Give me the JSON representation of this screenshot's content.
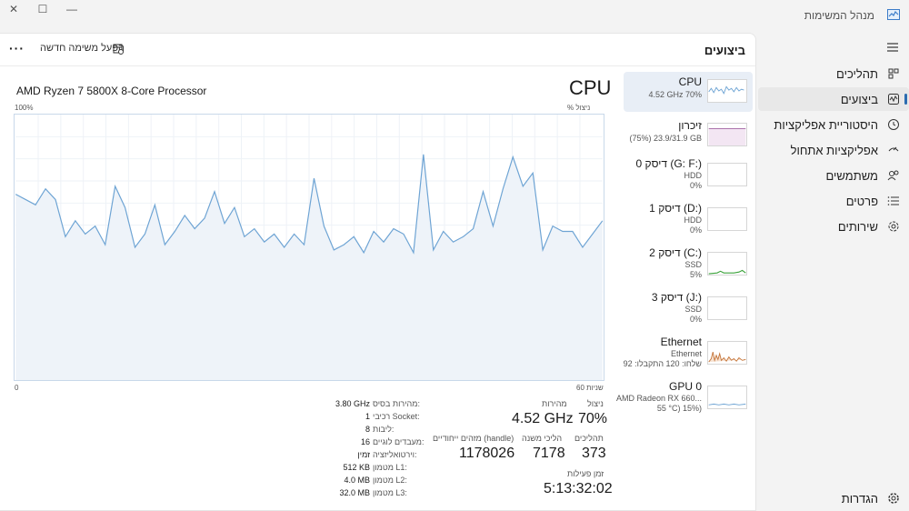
{
  "app": {
    "title": "מנהל המשימות",
    "icon": "task-manager-icon"
  },
  "window_buttons": {
    "close": "✕",
    "maximize": "☐",
    "minimize": "—"
  },
  "sidebar": {
    "items": [
      {
        "label": "תהליכים",
        "icon": "processes-icon"
      },
      {
        "label": "ביצועים",
        "icon": "performance-icon",
        "active": true
      },
      {
        "label": "היסטוריית אפליקציות",
        "icon": "history-icon"
      },
      {
        "label": "אפליקציות אתחול",
        "icon": "startup-icon"
      },
      {
        "label": "משתמשים",
        "icon": "users-icon"
      },
      {
        "label": "פרטים",
        "icon": "details-icon"
      },
      {
        "label": "שירותים",
        "icon": "services-icon"
      }
    ],
    "settings_label": "הגדרות"
  },
  "header": {
    "title": "ביצועים",
    "new_task": "הפעל משימה חדשה",
    "more": "···"
  },
  "perf_items": [
    {
      "title": "CPU",
      "sub1": "4.52 GHz  70%",
      "sub2": "",
      "thumb": "cpu",
      "active": true
    },
    {
      "title": "זיכרון",
      "sub1": "(75%) 23.9/31.9 GB",
      "sub2": "",
      "thumb": "memory"
    },
    {
      "title": "דיסק 0 (G: F:)",
      "sub1": "HDD",
      "sub2": "0%",
      "thumb": "disk"
    },
    {
      "title": "דיסק 1 (D:)",
      "sub1": "HDD",
      "sub2": "0%",
      "thumb": "disk"
    },
    {
      "title": "דיסק 2 (C:)",
      "sub1": "SSD",
      "sub2": "5%",
      "thumb": "disk-active"
    },
    {
      "title": "דיסק 3 (J:)",
      "sub1": "SSD",
      "sub2": "0%",
      "thumb": "disk"
    },
    {
      "title": "Ethernet",
      "sub1": "Ethernet",
      "sub2": "שלחו: 120 התקבלו: 92",
      "thumb": "ethernet"
    },
    {
      "title": "GPU 0",
      "sub1": "AMD Radeon RX 660...",
      "sub2": "55 °C) 15%)",
      "thumb": "gpu"
    }
  ],
  "cpu": {
    "title": "CPU",
    "model": "AMD Ryzen 7 5800X 8-Core Processor",
    "y_max_label": "100%",
    "y_unit_label": "% ניצול",
    "x_left_label": "0",
    "x_right_label": "60 שניות"
  },
  "stats": {
    "utilization_label": "ניצול",
    "utilization": "70%",
    "speed_label": "מהירות",
    "speed": "4.52 GHz",
    "processes_label": "תהליכים",
    "processes": "373",
    "threads_label": "הליכי משנה",
    "threads": "7178",
    "handles_label": "מזהים ייחודיים (handle)",
    "handles": "1178026",
    "uptime_label": "זמן פעילות",
    "uptime": "5:13:32:02"
  },
  "specs": [
    {
      "key": "מהירות בסיס:",
      "value": "3.80 GHz"
    },
    {
      "key": "רכיבי Socket:",
      "value": "1"
    },
    {
      "key": "ליבות:",
      "value": "8"
    },
    {
      "key": "מעבדים לוגיים:",
      "value": "16"
    },
    {
      "key": "וירטואליזציה:",
      "value": "זמין"
    },
    {
      "key": "מטמון L1:",
      "value": "512 KB"
    },
    {
      "key": "מטמון L2:",
      "value": "4.0 MB"
    },
    {
      "key": "מטמון L3:",
      "value": "32.0 MB"
    }
  ],
  "chart_data": {
    "type": "area",
    "ylim": [
      0,
      100
    ],
    "xlim": [
      0,
      60
    ],
    "color": "#6ea4d4",
    "fill": "#eef3f9",
    "values": [
      70,
      68,
      66,
      72,
      68,
      54,
      60,
      55,
      58,
      51,
      73,
      65,
      50,
      55,
      66,
      51,
      56,
      62,
      57,
      61,
      71,
      59,
      65,
      54,
      57,
      52,
      55,
      50,
      55,
      51,
      76,
      58,
      49,
      51,
      54,
      48,
      56,
      52,
      57,
      55,
      48,
      85,
      49,
      56,
      52,
      54,
      57,
      71,
      58,
      72,
      84,
      73,
      78,
      49,
      58,
      56,
      56,
      50,
      55,
      60
    ]
  },
  "colors": {
    "accent": "#2b6cb0",
    "cpu_line": "#6ea4d4",
    "memory": "#a05fa0",
    "disk_active": "#3ca33c",
    "ethernet": "#c5753a"
  }
}
